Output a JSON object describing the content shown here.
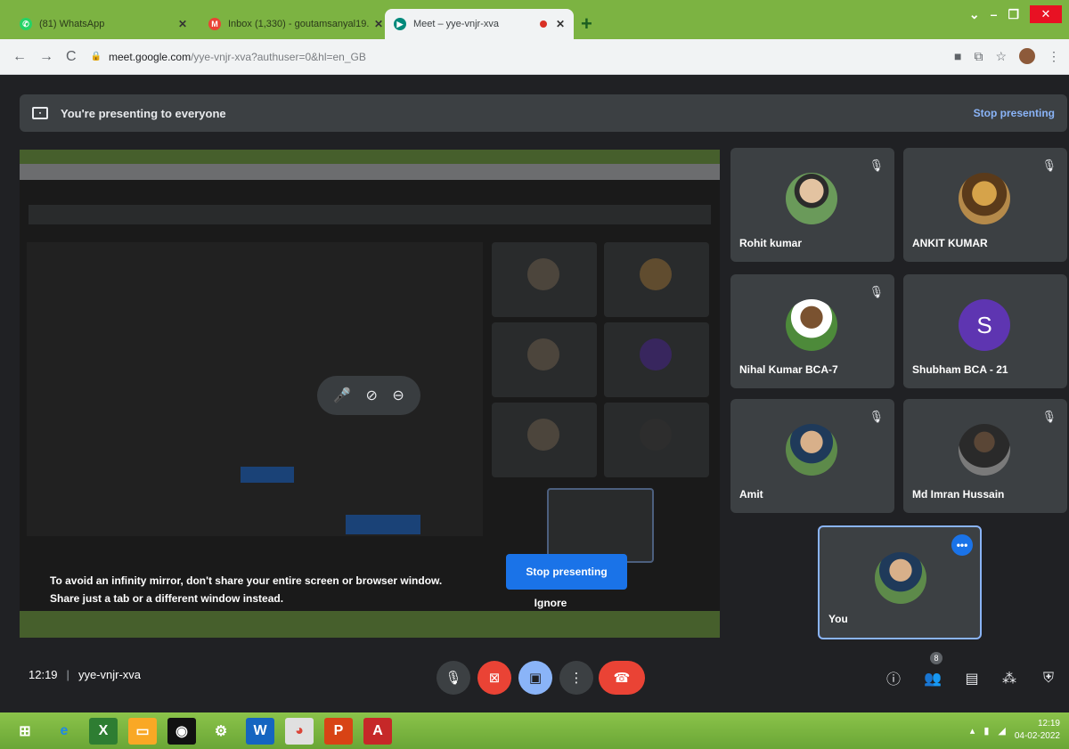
{
  "browser": {
    "tabs": [
      {
        "title": "(81) WhatsApp",
        "favicon": "whatsapp-icon",
        "color": "#25d366"
      },
      {
        "title": "Inbox (1,330) - goutamsanyal19...",
        "favicon": "gmail-icon",
        "color": "#ea4335"
      },
      {
        "title": "Meet – yye-vnjr-xva",
        "favicon": "meet-icon",
        "color": "#00897b"
      }
    ],
    "new_tab": "+",
    "url_host": "meet.google.com",
    "url_path": "/yye-vnjr-xva?authuser=0&hl=en_GB"
  },
  "meet": {
    "banner_text": "You're presenting to everyone",
    "banner_link": "Stop presenting",
    "warning_line1": "To avoid an infinity mirror, don't share your entire screen or browser window.",
    "warning_line2": "Share just a tab or a different window instead.",
    "stop_button": "Stop presenting",
    "ignore_button": "Ignore",
    "participants": [
      {
        "name": "Rohit kumar",
        "avatar": "photo"
      },
      {
        "name": "ANKIT KUMAR",
        "avatar": "photo"
      },
      {
        "name": "Nihal Kumar BCA-7",
        "avatar": "photo"
      },
      {
        "name": "Shubham BCA - 21",
        "avatar": "letter",
        "letter": "S"
      },
      {
        "name": "Amit",
        "avatar": "photo"
      },
      {
        "name": "Md Imran Hussain",
        "avatar": "photo"
      },
      {
        "name": "You",
        "avatar": "photo"
      }
    ],
    "time": "12:19",
    "meeting_code": "yye-vnjr-xva",
    "people_count": "8"
  },
  "taskbar": {
    "time": "12:19",
    "date": "04-02-2022"
  },
  "colors": {
    "accent": "#1a73e8",
    "end_call": "#ea4335",
    "taskbar": "#7cb342"
  }
}
